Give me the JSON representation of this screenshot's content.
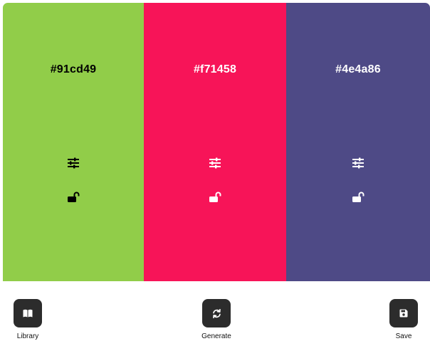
{
  "palette": {
    "swatches": [
      {
        "hex": "#91cd49",
        "background": "#91cd49",
        "foreground": "#000000",
        "adjust_icon": "sliders-icon",
        "lock_icon": "unlock-icon"
      },
      {
        "hex": "#f71458",
        "background": "#f71458",
        "foreground": "#ffffff",
        "adjust_icon": "sliders-icon",
        "lock_icon": "unlock-icon"
      },
      {
        "hex": "#4e4a86",
        "background": "#4e4a86",
        "foreground": "#ffffff",
        "adjust_icon": "sliders-icon",
        "lock_icon": "unlock-icon"
      }
    ]
  },
  "toolbar": {
    "library": {
      "label": "Library",
      "icon": "book-open-icon"
    },
    "generate": {
      "label": "Generate",
      "icon": "refresh-icon"
    },
    "save": {
      "label": "Save",
      "icon": "floppy-disk-icon"
    },
    "button_color": "#2c2c2c"
  }
}
